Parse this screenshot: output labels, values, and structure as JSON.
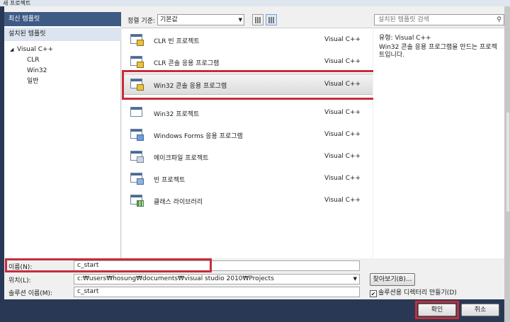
{
  "window": {
    "title": "새 프로젝트"
  },
  "left": {
    "recent_templates": "최신 템플릿",
    "installed_templates": "설치된 템플릿",
    "tree": {
      "root": "Visual C++",
      "children": [
        "CLR",
        "Win32",
        "일반"
      ]
    }
  },
  "header": {
    "sort_label": "정렬 기준:",
    "sort_value": "기본값",
    "search_placeholder": "설치된 템플릿 검색"
  },
  "templates": [
    {
      "name": "CLR 빈 프로젝트",
      "type": "Visual C++",
      "icon": "clr-empty-project-icon"
    },
    {
      "name": "CLR 콘솔 응용 프로그램",
      "type": "Visual C++",
      "icon": "clr-console-app-icon"
    },
    {
      "name": "Win32 콘솔 응용 프로그램",
      "type": "Visual C++",
      "icon": "win32-console-app-icon",
      "selected": true
    },
    {
      "name": "Win32 프로젝트",
      "type": "Visual C++",
      "icon": "win32-project-icon"
    },
    {
      "name": "Windows Forms 응용 프로그램",
      "type": "Visual C++",
      "icon": "windows-forms-app-icon"
    },
    {
      "name": "메이크파일 프로젝트",
      "type": "Visual C++",
      "icon": "makefile-project-icon"
    },
    {
      "name": "빈 프로젝트",
      "type": "Visual C++",
      "icon": "empty-project-icon"
    },
    {
      "name": "클래스 라이브러리",
      "type": "Visual C++",
      "icon": "class-library-icon"
    }
  ],
  "details": {
    "type_line": "유형:  Visual C++",
    "description": "Win32 콘솔 응용 프로그램을 만드는 프로젝트입니다."
  },
  "form": {
    "name_label": "이름(N):",
    "name_value": "c_start",
    "location_label": "위치(L):",
    "location_value": "c:₩users₩hosung₩documents₩visual studio 2010₩Projects",
    "browse_button": "찾아보기(B)...",
    "solution_label": "솔루션 이름(M):",
    "solution_value": "c_start",
    "create_dir_label": "솔루션용 디렉터리 만들기(D)",
    "create_dir_checked": true
  },
  "buttons": {
    "ok": "확인",
    "cancel": "취소"
  },
  "colors": {
    "highlight": "#c62d39",
    "header_blue": "#3e5b85",
    "frame": "#293955"
  }
}
